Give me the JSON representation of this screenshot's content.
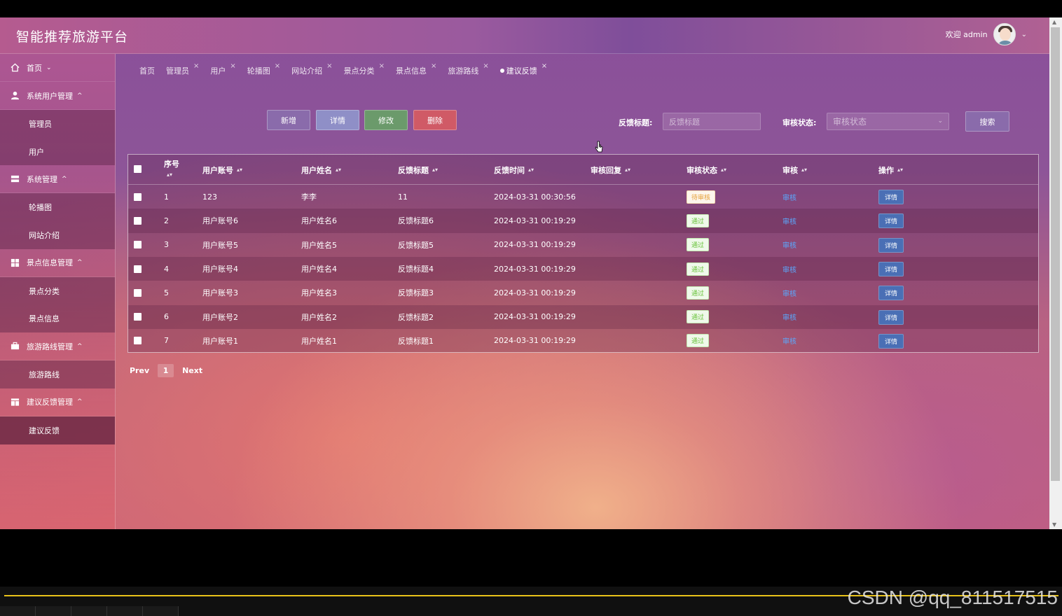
{
  "header": {
    "title": "智能推荐旅游平台",
    "welcome": "欢迎 admin"
  },
  "sidebar": {
    "groups": [
      {
        "label": "首页",
        "icon": "home-icon",
        "children": []
      },
      {
        "label": "系统用户管理",
        "icon": "user-icon",
        "children": [
          "管理员",
          "用户"
        ]
      },
      {
        "label": "系统管理",
        "icon": "server-icon",
        "children": [
          "轮播图",
          "网站介绍"
        ]
      },
      {
        "label": "景点信息管理",
        "icon": "grid-icon",
        "children": [
          "景点分类",
          "景点信息"
        ]
      },
      {
        "label": "旅游路线管理",
        "icon": "briefcase-icon",
        "children": [
          "旅游路线"
        ]
      },
      {
        "label": "建议反馈管理",
        "icon": "table-icon",
        "children": [
          "建议反馈"
        ]
      }
    ]
  },
  "tabs": [
    "首页",
    "管理员",
    "用户",
    "轮播图",
    "网站介绍",
    "景点分类",
    "景点信息",
    "旅游路线",
    "建议反馈"
  ],
  "toolbar": {
    "add": "新增",
    "detail": "详情",
    "edit": "修改",
    "delete": "删除"
  },
  "filters": {
    "title_label": "反馈标题:",
    "title_placeholder": "反馈标题",
    "status_label": "审核状态:",
    "status_placeholder": "审核状态",
    "search": "搜索"
  },
  "table": {
    "columns": [
      "序号",
      "用户账号",
      "用户姓名",
      "反馈标题",
      "反馈时间",
      "审核回复",
      "审核状态",
      "审核",
      "操作"
    ],
    "rows": [
      {
        "no": "1",
        "account": "123",
        "name": "李李",
        "title": "11",
        "time": "2024-03-31 00:30:56",
        "reply": "",
        "status": "待审核",
        "review": "审核",
        "action": "详情"
      },
      {
        "no": "2",
        "account": "用户账号6",
        "name": "用户姓名6",
        "title": "反馈标题6",
        "time": "2024-03-31 00:19:29",
        "reply": "",
        "status": "通过",
        "review": "审核",
        "action": "详情"
      },
      {
        "no": "3",
        "account": "用户账号5",
        "name": "用户姓名5",
        "title": "反馈标题5",
        "time": "2024-03-31 00:19:29",
        "reply": "",
        "status": "通过",
        "review": "审核",
        "action": "详情"
      },
      {
        "no": "4",
        "account": "用户账号4",
        "name": "用户姓名4",
        "title": "反馈标题4",
        "time": "2024-03-31 00:19:29",
        "reply": "",
        "status": "通过",
        "review": "审核",
        "action": "详情"
      },
      {
        "no": "5",
        "account": "用户账号3",
        "name": "用户姓名3",
        "title": "反馈标题3",
        "time": "2024-03-31 00:19:29",
        "reply": "",
        "status": "通过",
        "review": "审核",
        "action": "详情"
      },
      {
        "no": "6",
        "account": "用户账号2",
        "name": "用户姓名2",
        "title": "反馈标题2",
        "time": "2024-03-31 00:19:29",
        "reply": "",
        "status": "通过",
        "review": "审核",
        "action": "详情"
      },
      {
        "no": "7",
        "account": "用户账号1",
        "name": "用户姓名1",
        "title": "反馈标题1",
        "time": "2024-03-31 00:19:29",
        "reply": "",
        "status": "通过",
        "review": "审核",
        "action": "详情"
      }
    ]
  },
  "pager": {
    "prev": "Prev",
    "page": "1",
    "next": "Next"
  },
  "watermark": "CSDN @qq_811517515",
  "colors": {
    "add": "#8a6bab",
    "detail": "#8f8fc7",
    "edit": "#6b9a6b",
    "delete": "#d05a66",
    "link": "#5aa9ff",
    "progress": "#e8c21a"
  }
}
